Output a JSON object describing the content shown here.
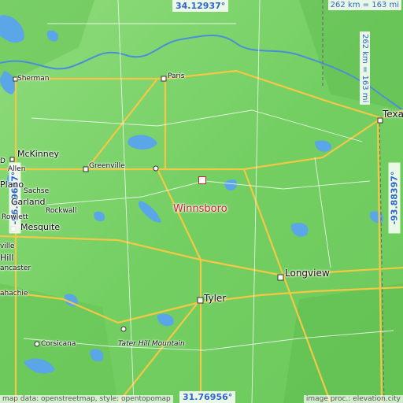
{
  "map": {
    "coord_top": "34.12937°",
    "coord_bottom": "31.76956°",
    "coord_left": "-96.69647°",
    "coord_right": "-93.88397°",
    "scale_top": "262 km = 163 mi",
    "scale_right": "262 km = 163 mi",
    "target": "Winnsboro",
    "credit_left": "map data: openstreetmap, style: opentopomap",
    "credit_right": "image proc.: elevation.city"
  },
  "places": {
    "texarkana": "Texa",
    "sherman": "Sherman",
    "paris": "Paris",
    "mckinney": "McKinney",
    "allen": "Allen",
    "greenville": "Greenville",
    "plano": "Plano",
    "sachse": "Sachse",
    "garland": "Garland",
    "rockwall": "Rockwall",
    "rowlett": "Rowlett",
    "mesquite": "Mesquite",
    "hill": "Hill",
    "lancaster": "ancaster",
    "waxahachie": "ahachie",
    "corsicana": "Corsicana",
    "tater_hill": "Tater Hill Mountain",
    "tyler": "Tyler",
    "longview": "Longview",
    "ville": "ville",
    "d_left": "D"
  },
  "colors": {
    "land": "#7bd36a",
    "water": "#5aa6e6",
    "highway": "#f3c845",
    "target": "#d2232a",
    "coord_text": "#2f64c8"
  }
}
